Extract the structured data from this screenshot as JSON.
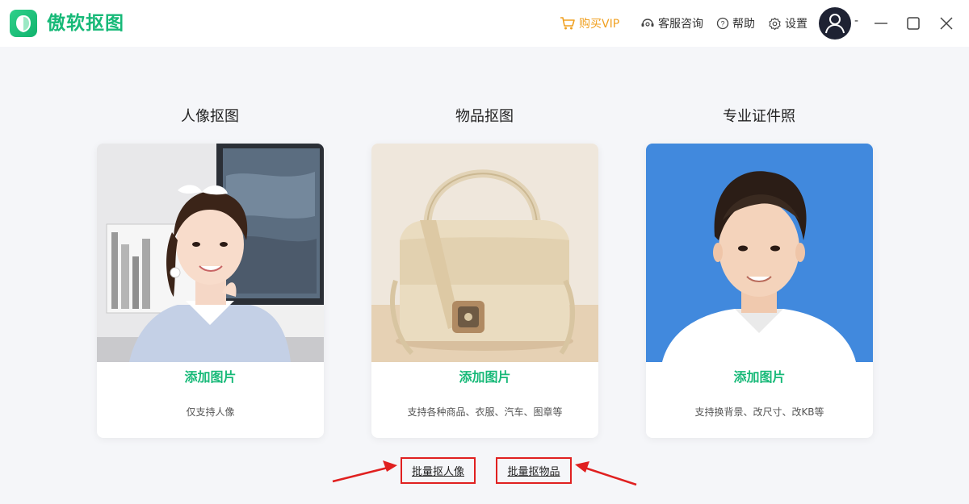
{
  "app": {
    "title": "傲软抠图"
  },
  "toolbar": {
    "vip_label": "购买VIP",
    "service_label": "客服咨询",
    "help_label": "帮助",
    "settings_label": "设置",
    "user_name": "-"
  },
  "colors": {
    "brand": "#17b978",
    "vip": "#f0a020",
    "highlight": "#e02020",
    "id_photo_bg": "#4189dd"
  },
  "cards": [
    {
      "title": "人像抠图",
      "action": "添加图片",
      "desc": "仅支持人像"
    },
    {
      "title": "物品抠图",
      "action": "添加图片",
      "desc": "支持各种商品、衣服、汽车、图章等"
    },
    {
      "title": "专业证件照",
      "action": "添加图片",
      "desc": "支持换背景、改尺寸、改KB等"
    }
  ],
  "batch": {
    "portrait_label": "批量抠人像",
    "item_label": "批量抠物品"
  },
  "icons": [
    "logo-icon",
    "cart-icon",
    "headset-icon",
    "help-icon",
    "gear-icon",
    "user-avatar-icon",
    "minimize-icon",
    "maximize-icon",
    "close-icon",
    "arrow-icon"
  ]
}
